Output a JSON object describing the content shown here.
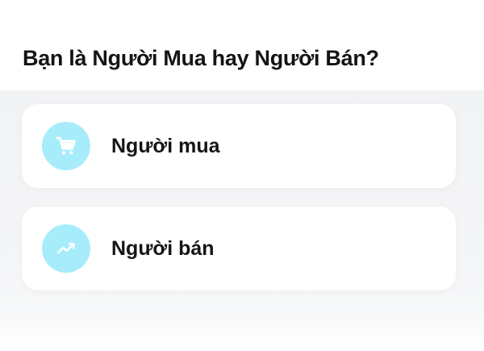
{
  "question": "Bạn là Người Mua hay Người Bán?",
  "options": [
    {
      "label": "Người mua",
      "icon": "shopping-cart-icon"
    },
    {
      "label": "Người bán",
      "icon": "trending-up-icon"
    }
  ],
  "colors": {
    "icon_circle": "#a7ecfb",
    "icon_glyph": "#ffffff",
    "card_background": "#ffffff",
    "panel_background": "#f3f4f6"
  }
}
